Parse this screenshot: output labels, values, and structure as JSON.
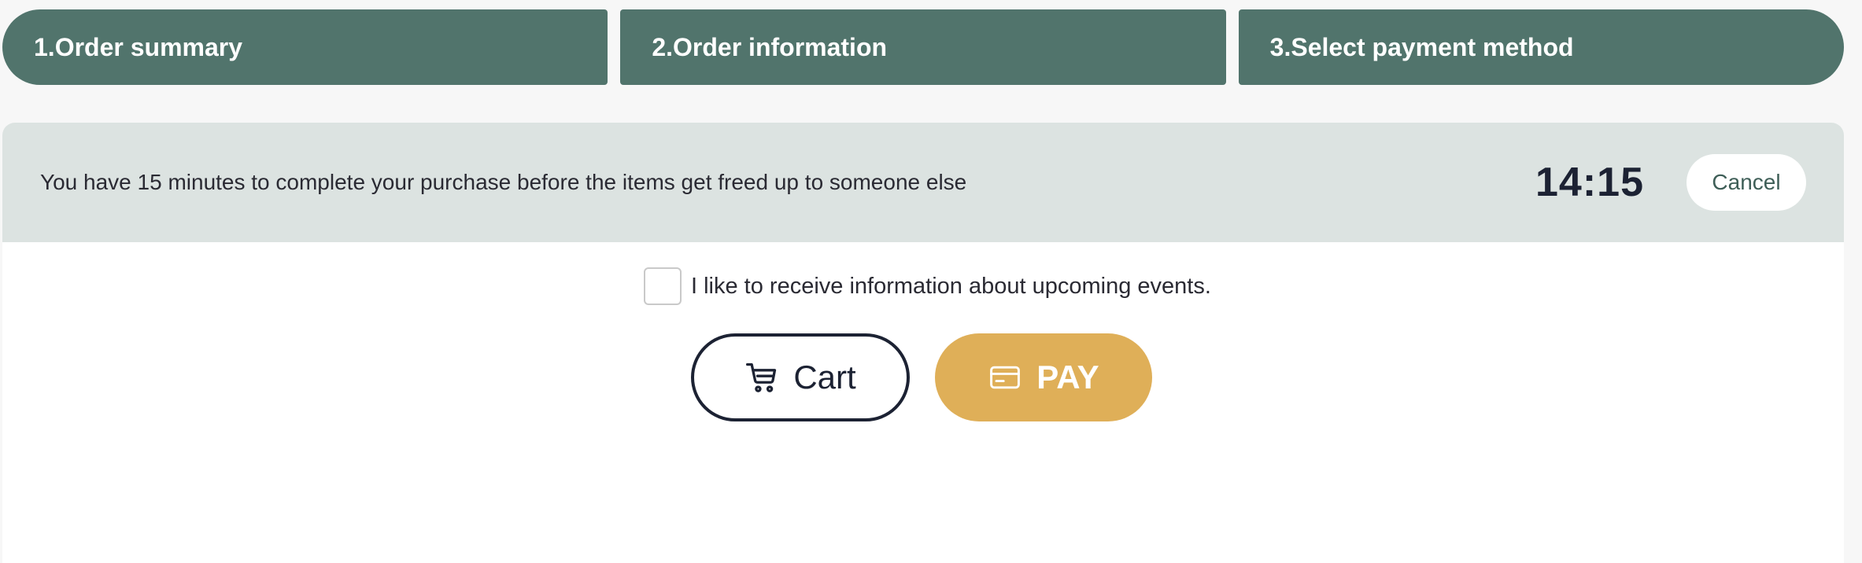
{
  "steps": [
    {
      "label": "1.Order summary"
    },
    {
      "label": "2.Order information"
    },
    {
      "label": "3.Select payment method"
    }
  ],
  "timer": {
    "message": "You have 15 minutes to complete your purchase before the items get freed up to someone else",
    "time_remaining": "14:15",
    "cancel_label": "Cancel"
  },
  "optin": {
    "label": "I like to receive information about upcoming events.",
    "checked": false
  },
  "actions": {
    "cart_label": "Cart",
    "cart_icon": "cart-icon",
    "pay_label": "PAY",
    "pay_icon": "credit-card-icon"
  },
  "colors": {
    "step_bg": "#51746c",
    "timer_bar_bg": "#dce3e1",
    "pay_bg": "#dfaf58",
    "dark_text": "#1c2233"
  }
}
